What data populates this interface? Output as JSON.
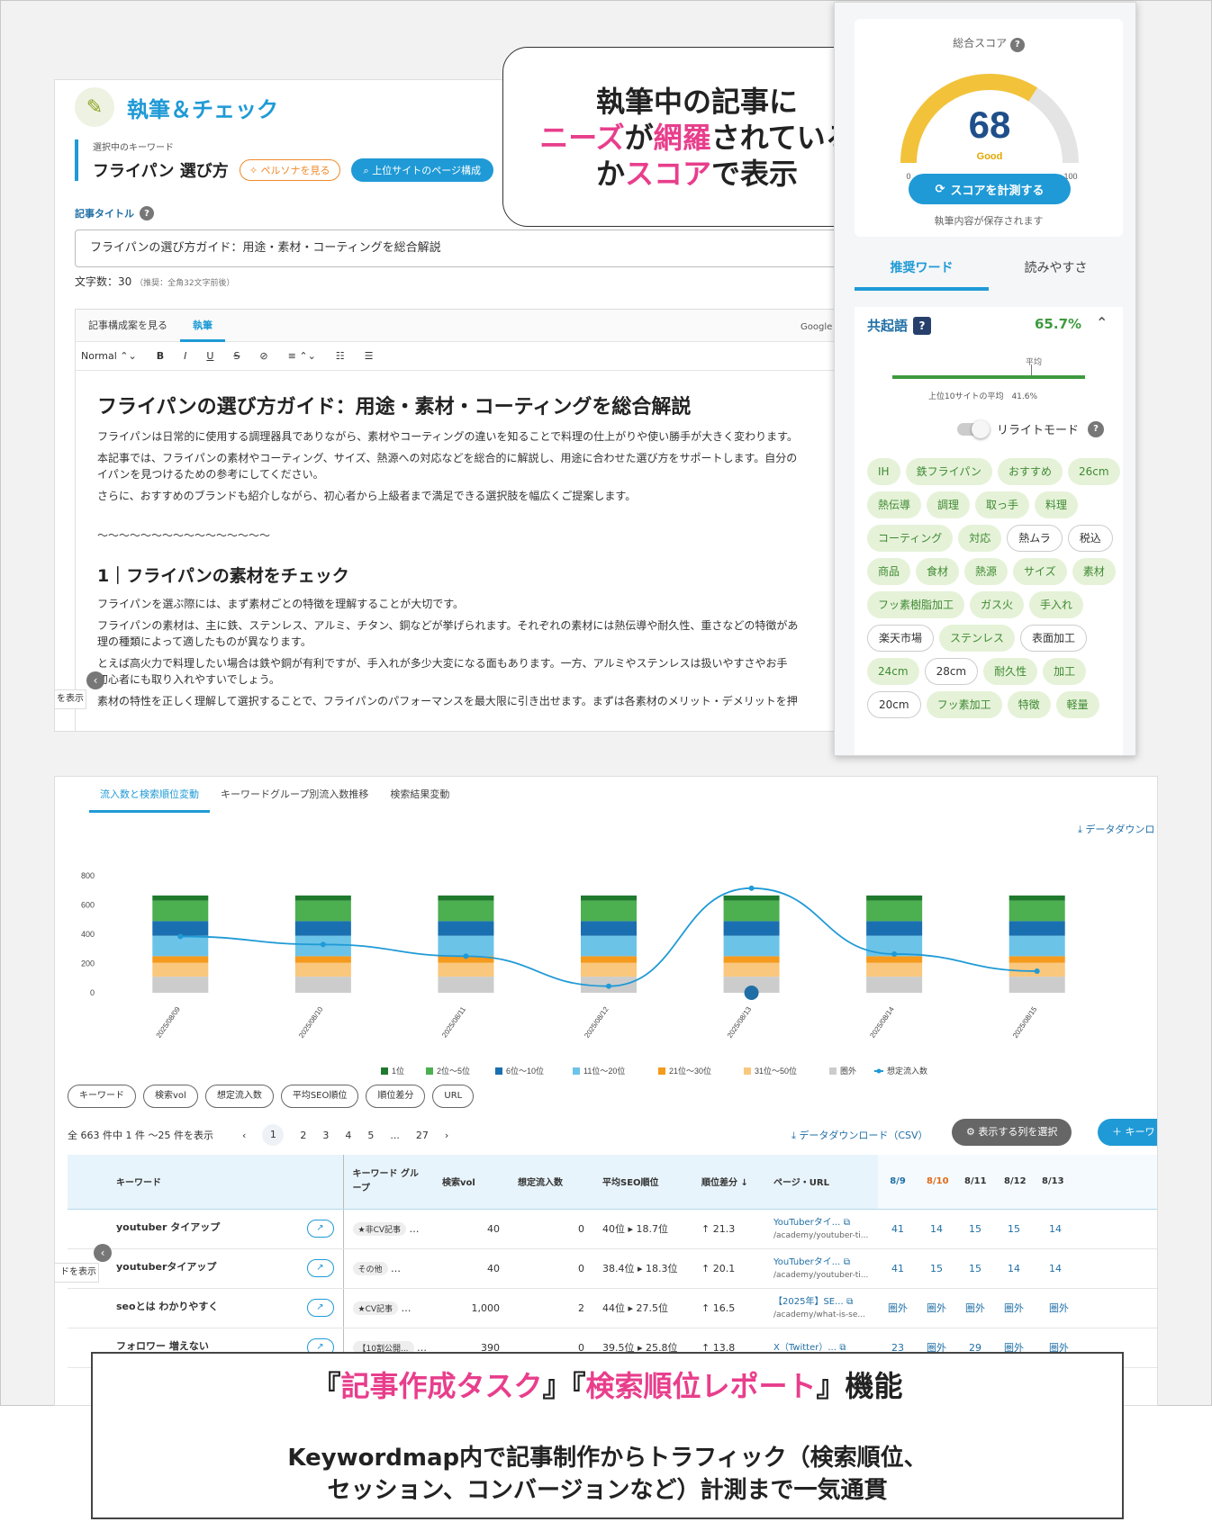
{
  "editor": {
    "title": "執筆＆チェック",
    "keyword_label": "選択中のキーワード",
    "keyword": "フライパン 選び方",
    "persona_button": "ペルソナを見る",
    "pages_button": "上位サイトのページ構成",
    "title_label": "記事タイトル",
    "title_value": "フライパンの選び方ガイド：用途・素材・コーティングを総合解説",
    "char_count": "文字数：30",
    "char_hint": "（推奨：全角32文字前後）",
    "tabs": [
      "記事構成案を見る",
      "執筆"
    ],
    "gdocs": "Google Docsで執",
    "toolbar": [
      "Normal ⌃⌄",
      "B",
      "I",
      "U",
      "S",
      "⊘",
      "≡ ⌃⌄",
      "☷",
      "☰"
    ],
    "doc_h1": "フライパンの選び方ガイド：用途・素材・コーティングを総合解説",
    "doc_paras": [
      "フライパンは日常的に使用する調理器具でありながら、素材やコーティングの違いを知ることで料理の仕上がりや使い勝手が大きく変わります。",
      "本記事では、フライパンの素材やコーティング、サイズ、熱源への対応などを総合的に解説し、用途に合わせた選び方をサポートします。自分の",
      "イパンを見つけるための参考にしてください。",
      "さらに、おすすめのブランドも紹介しながら、初心者から上級者まで満足できる選択肢を幅広くご提案します。"
    ],
    "tilde": "〜〜〜〜〜〜〜〜〜〜〜〜〜〜〜〜",
    "doc_h2": "1｜フライパンの素材をチェック",
    "doc_paras2": [
      "フライパンを選ぶ際には、まず素材ごとの特徴を理解することが大切です。",
      "フライパンの素材は、主に鉄、ステンレス、アルミ、チタン、銅などが挙げられます。それぞれの素材には熱伝導や耐久性、重さなどの特徴があ",
      "理の種類によって適したものが異なります。",
      "とえば高火力で料理したい場合は鉄や銅が有利ですが、手入れが多少大変になる面もあります。一方、アルミやステンレスは扱いやすさやお手",
      "初心者にも取り入れやすいでしょう。",
      "素材の特性を正しく理解して選択することで、フライパンのパフォーマンスを最大限に引き出せます。まずは各素材のメリット・デメリットを押"
    ],
    "side_label": "を表示"
  },
  "bubble": {
    "line1": "執筆中の記事に",
    "line2a": "ニーズ",
    "line2b": "が",
    "line2c": "網羅",
    "line2d": "されている",
    "line3a": "か",
    "line3b": "スコア",
    "line3c": "で表示"
  },
  "score": {
    "label": "総合スコア",
    "value": 68,
    "max": 100,
    "min_label": "0",
    "max_label": "100",
    "grade": "Good",
    "button": "スコアを計測する",
    "note": "執筆内容が保存されます",
    "tabs": [
      "推奨ワード",
      "読みやすさ"
    ],
    "co_title": "共起語",
    "co_pct": "65.7%",
    "avg_label": "平均",
    "top10": "上位10サイトの平均　41.6%",
    "rewrite": "リライトモード",
    "chips": [
      {
        "t": "IH",
        "s": "g"
      },
      {
        "t": "鉄フライパン",
        "s": "g"
      },
      {
        "t": "おすすめ",
        "s": "g"
      },
      {
        "t": "26cm",
        "s": "g"
      },
      {
        "t": "熱伝導",
        "s": "g"
      },
      {
        "t": "調理",
        "s": "g"
      },
      {
        "t": "取っ手",
        "s": "g"
      },
      {
        "t": "料理",
        "s": "g"
      },
      {
        "t": "コーティング",
        "s": "g"
      },
      {
        "t": "対応",
        "s": "g"
      },
      {
        "t": "熱ムラ",
        "s": "w"
      },
      {
        "t": "税込",
        "s": "w"
      },
      {
        "t": "商品",
        "s": "g"
      },
      {
        "t": "食材",
        "s": "g"
      },
      {
        "t": "熱源",
        "s": "g"
      },
      {
        "t": "サイズ",
        "s": "g"
      },
      {
        "t": "素材",
        "s": "g"
      },
      {
        "t": "フッ素樹脂加工",
        "s": "g"
      },
      {
        "t": "ガス火",
        "s": "g"
      },
      {
        "t": "手入れ",
        "s": "g"
      },
      {
        "t": "楽天市場",
        "s": "w"
      },
      {
        "t": "ステンレス",
        "s": "g"
      },
      {
        "t": "表面加工",
        "s": "w"
      },
      {
        "t": "24cm",
        "s": "g"
      },
      {
        "t": "28cm",
        "s": "w"
      },
      {
        "t": "耐久性",
        "s": "g"
      },
      {
        "t": "加工",
        "s": "g"
      },
      {
        "t": "20cm",
        "s": "w"
      },
      {
        "t": "フッ素加工",
        "s": "g"
      },
      {
        "t": "特徴",
        "s": "g"
      },
      {
        "t": "軽量",
        "s": "g"
      }
    ]
  },
  "report": {
    "tabs": [
      "流入数と検索順位変動",
      "キーワードグループ別流入数推移",
      "検索結果変動"
    ],
    "download": "データダウンロ",
    "filters": [
      "キーワード",
      "検索vol",
      "想定流入数",
      "平均SEO順位",
      "順位差分",
      "URL"
    ],
    "pager_total": "全 663 件中 1 件 ～25 件を表示",
    "pages": [
      "‹",
      "1",
      "2",
      "3",
      "4",
      "5",
      "...",
      "27",
      "›"
    ],
    "csv": "データダウンロード（CSV）",
    "col_select": "表示する列を選択",
    "add_kw": "＋ キーワ",
    "columns": [
      "キーワード",
      "キーワード グループ",
      "検索vol",
      "想定流入数",
      "平均SEO順位",
      "順位差分 ↓",
      "ページ・URL",
      "8/9",
      "8/10",
      "8/11",
      "8/12",
      "8/13"
    ],
    "rows": [
      {
        "kw": "youtuber タイアップ",
        "grp": "★非CV記事",
        "vol": "40",
        "inflow": "0",
        "rank_from": "40位",
        "rank_to": "18.7位",
        "diff": "21.3",
        "url_t": "YouTuberタイ...",
        "url_s": "/academy/youtuber-ti...",
        "d": [
          "41",
          "14",
          "15",
          "15",
          "14"
        ]
      },
      {
        "kw": "youtuberタイアップ",
        "grp": "その他",
        "vol": "40",
        "inflow": "0",
        "rank_from": "38.4位",
        "rank_to": "18.3位",
        "diff": "20.1",
        "url_t": "YouTuberタイ...",
        "url_s": "/academy/youtuber-ti...",
        "d": [
          "41",
          "15",
          "15",
          "14",
          "14"
        ]
      },
      {
        "kw": "seoとは わかりやすく",
        "grp": "★CV記事",
        "vol": "1,000",
        "inflow": "2",
        "rank_from": "44位",
        "rank_to": "27.5位",
        "diff": "16.5",
        "url_t": "【2025年】SE...",
        "url_s": "/academy/what-is-se...",
        "d": [
          "圏外",
          "圏外",
          "圏外",
          "圏外",
          "圏外"
        ]
      },
      {
        "kw": "フォロワー 増えない",
        "grp": "【10割公開...",
        "vol": "390",
        "inflow": "0",
        "rank_from": "39.5位",
        "rank_to": "25.8位",
        "diff": "13.8",
        "url_t": "X（Twitter）...",
        "url_s": "",
        "d": [
          "23",
          "圏外",
          "29",
          "圏外",
          "圏外"
        ]
      }
    ],
    "side_label": "ドを表示"
  },
  "chart_data": {
    "type": "bar",
    "categories": [
      "2025/08/09",
      "2025/08/10",
      "2025/08/11",
      "2025/08/12",
      "2025/08/13",
      "2025/08/14",
      "2025/08/15"
    ],
    "ylim": [
      0,
      800
    ],
    "yticks": [
      0,
      200,
      400,
      600,
      800
    ],
    "series": [
      {
        "name": "圏外",
        "values": [
          110,
          110,
          110,
          110,
          110,
          110,
          110
        ],
        "color": "#cccccc"
      },
      {
        "name": "31位〜50位",
        "values": [
          95,
          95,
          95,
          95,
          95,
          95,
          95
        ],
        "color": "#f9c77d"
      },
      {
        "name": "21位〜30位",
        "values": [
          45,
          45,
          45,
          45,
          45,
          45,
          45
        ],
        "color": "#f59a1c"
      },
      {
        "name": "11位〜20位",
        "values": [
          140,
          140,
          140,
          140,
          140,
          140,
          140
        ],
        "color": "#6cc3e8"
      },
      {
        "name": "6位〜10位",
        "values": [
          100,
          100,
          100,
          100,
          100,
          100,
          100
        ],
        "color": "#1a6fb0"
      },
      {
        "name": "2位〜5位",
        "values": [
          140,
          140,
          140,
          140,
          140,
          140,
          140
        ],
        "color": "#4caf50"
      },
      {
        "name": "1位",
        "values": [
          35,
          35,
          35,
          35,
          35,
          35,
          35
        ],
        "color": "#1f7a2e"
      }
    ],
    "line": {
      "name": "想定流入数",
      "values": [
        385,
        330,
        250,
        45,
        715,
        265,
        148
      ],
      "color": "#1f9ad6"
    }
  },
  "caption": {
    "q1": "『",
    "t1": "記事作成タスク",
    "q2": "』『",
    "t2": "検索順位レポート",
    "q3": "』機能",
    "sub1": "Keywordmap内で記事制作からトラフィック（検索順位、",
    "sub2": "セッション、コンバージョンなど）計測まで一気通貫"
  }
}
